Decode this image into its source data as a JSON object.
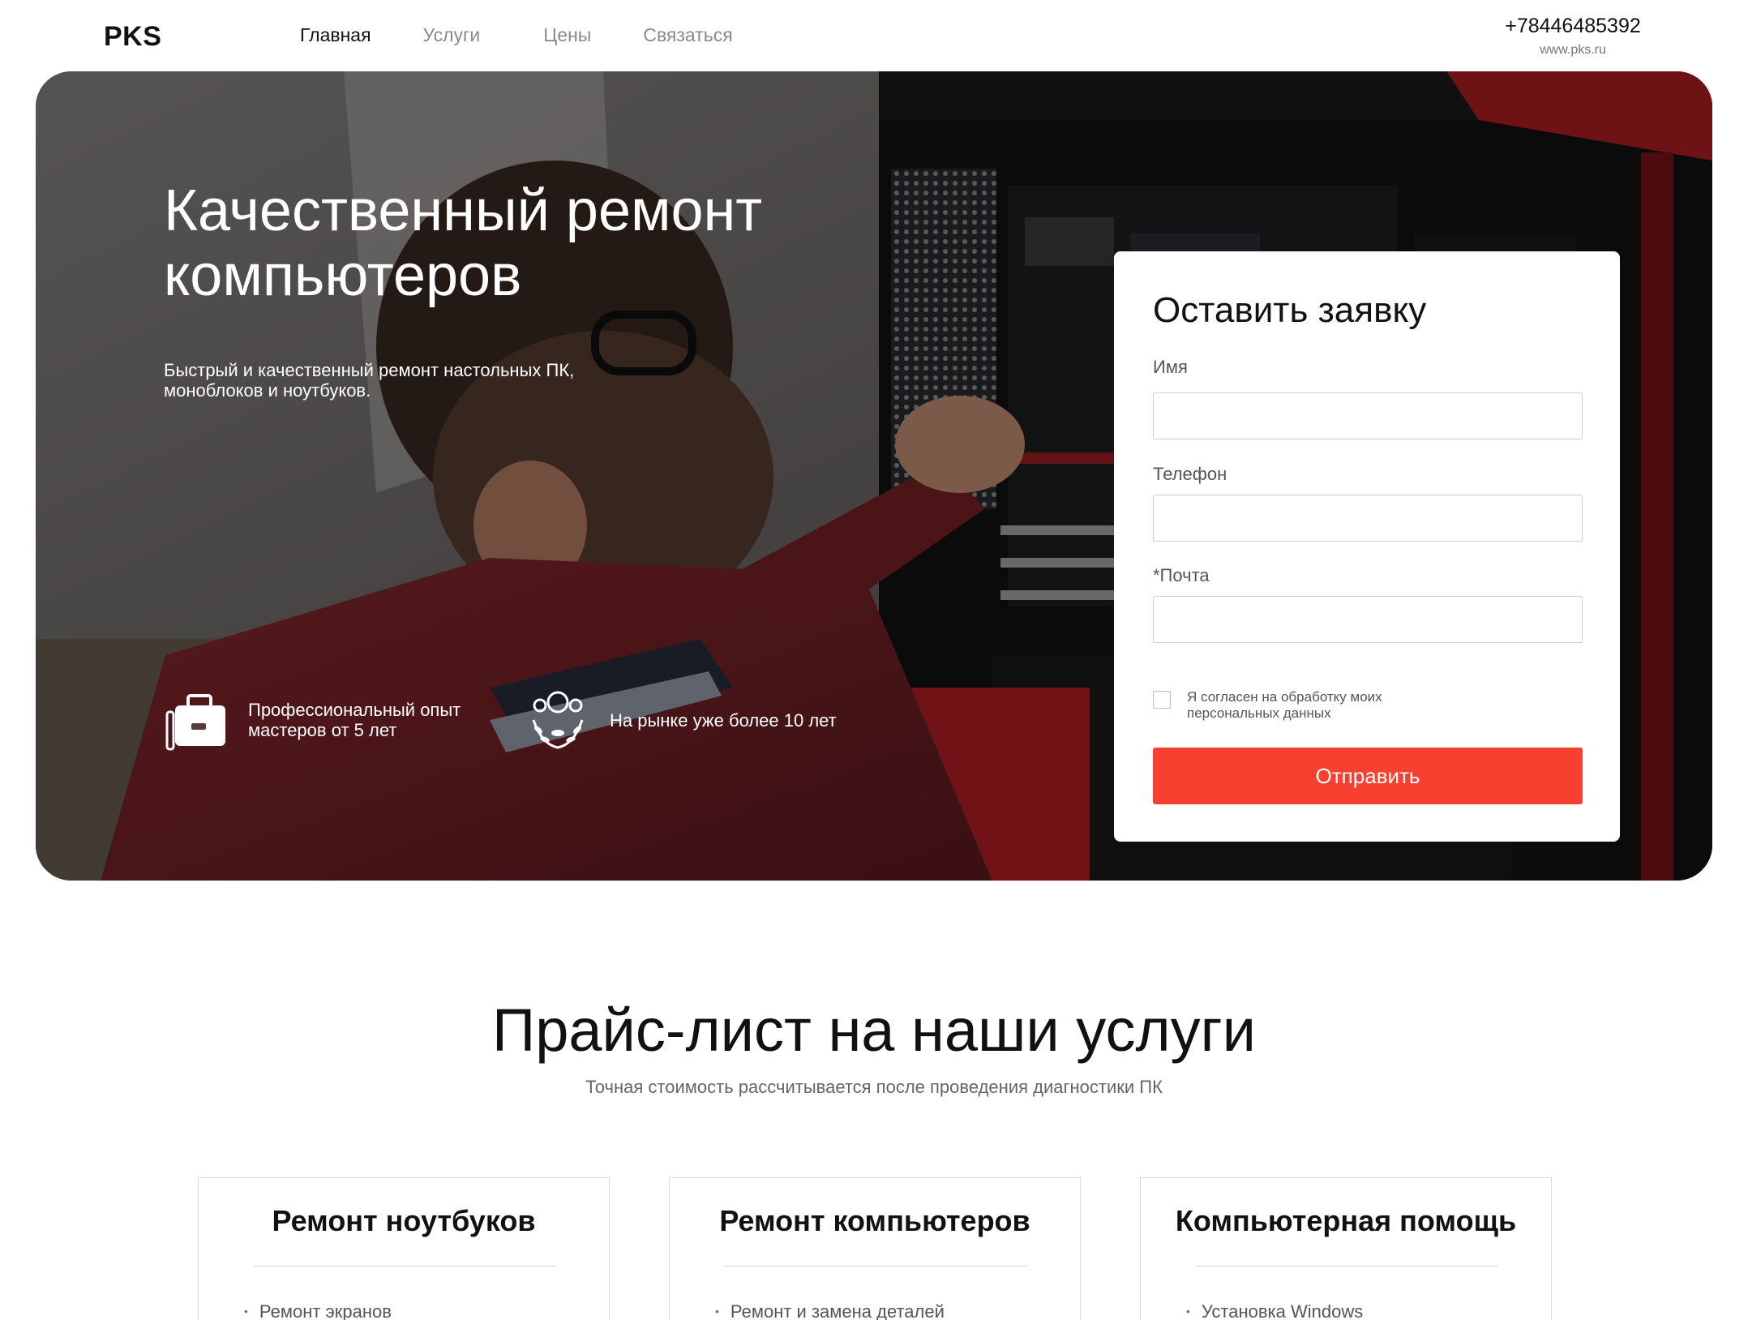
{
  "header": {
    "logo": "PKS",
    "nav": [
      {
        "label": "Главная",
        "active": true
      },
      {
        "label": "Услуги",
        "active": false
      },
      {
        "label": "Цены",
        "active": false
      },
      {
        "label": "Связаться",
        "active": false
      }
    ],
    "phone": "+78446485392",
    "site": "www.pks.ru"
  },
  "hero": {
    "title": "Качественный ремонт компьютеров",
    "subtitle": "Быстрый и качественный ремонт настольных ПК, моноблоков и ноутбуков.",
    "features": [
      {
        "icon": "briefcase-icon",
        "text": "Профессиональный опыт мастеров от 5 лет"
      },
      {
        "icon": "laurel-award-icon",
        "text": "На рынке уже более 10 лет"
      }
    ]
  },
  "form": {
    "title": "Оставить заявку",
    "fields": [
      {
        "label": "Имя",
        "value": ""
      },
      {
        "label": "Телефон",
        "value": ""
      },
      {
        "label": "*Почта",
        "value": ""
      }
    ],
    "agree_text": "Я согласен на обработку моих персональных данных",
    "agree_checked": false,
    "submit_label": "Отправить"
  },
  "pricing": {
    "title": "Прайс-лист на наши услуги",
    "subtitle": "Точная стоимость рассчитывается после проведения диагностики ПК",
    "cards": [
      {
        "title": "Ремонт ноутбуков",
        "first_item": "Ремонт экранов"
      },
      {
        "title": "Ремонт компьютеров",
        "first_item": "Ремонт и замена деталей"
      },
      {
        "title": "Компьютерная помощь",
        "first_item": "Установка Windows"
      }
    ]
  },
  "colors": {
    "accent": "#f7402f",
    "text": "#111111",
    "muted": "#8a8a8a"
  }
}
